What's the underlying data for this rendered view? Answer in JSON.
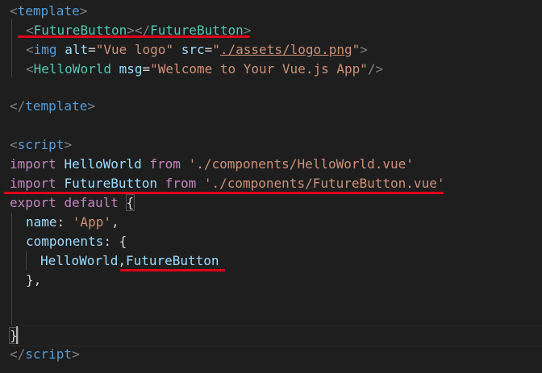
{
  "lines": {
    "l1": {
      "lt": "<",
      "tag": "template",
      "gt": ">"
    },
    "l2": {
      "lt": "<",
      "open": "FutureButton",
      "mid": "></",
      "close": "FutureButton",
      "gt": ">"
    },
    "l3": {
      "lt": "<",
      "tag": "img",
      "alt_attr": "alt",
      "eq1": "=",
      "alt_val": "\"Vue logo\"",
      "src_attr": "src",
      "eq2": "=",
      "q1": "\"",
      "src_val": "./assets/logo.png",
      "q2": "\"",
      "gt": ">"
    },
    "l4": {
      "lt": "<",
      "tag": "HelloWorld",
      "attr": "msg",
      "eq": "=",
      "val": "\"Welcome to Your Vue.js App\"",
      "gt": "/>"
    },
    "l6": {
      "lt": "</",
      "tag": "template",
      "gt": ">"
    },
    "l8": {
      "lt": "<",
      "tag": "script",
      "gt": ">"
    },
    "l9": {
      "kw": "import",
      "name": "HelloWorld",
      "from": "from",
      "path": "'./components/HelloWorld.vue'"
    },
    "l10": {
      "kw": "import",
      "name": "FutureButton",
      "from": "from",
      "path": "'./components/FutureButton.vue'"
    },
    "l11": {
      "kw1": "export",
      "kw2": "default",
      "brace": "{"
    },
    "l12": {
      "key": "name",
      "colon": ": ",
      "val": "'App'",
      "comma": ","
    },
    "l13": {
      "key": "components",
      "colon": ": ",
      "brace": "{"
    },
    "l14": {
      "a": "HelloWorld",
      "comma": ",",
      "b": "FutureButton"
    },
    "l15": {
      "text": "},"
    },
    "l18": {
      "text": "}"
    },
    "l19": {
      "lt": "</",
      "tag": "script",
      "gt": ">"
    }
  },
  "colors": {
    "background": "#1e1e1e",
    "tag": "#569cd6",
    "component": "#4ec9b0",
    "attribute": "#9cdcfe",
    "string": "#ce9178",
    "keyword": "#c586c0",
    "annotation_underline": "#e0001a"
  }
}
